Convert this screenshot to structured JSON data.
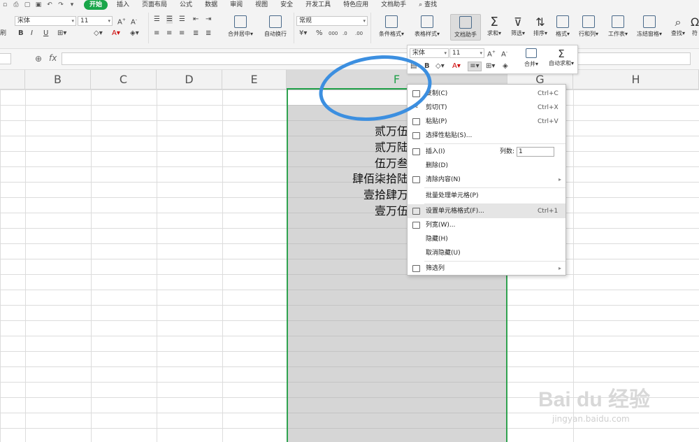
{
  "tabs": [
    "开始",
    "插入",
    "页面布局",
    "公式",
    "数据",
    "审阅",
    "视图",
    "安全",
    "开发工具",
    "特色应用",
    "文档助手",
    "查找"
  ],
  "ribbon": {
    "font_name": "宋体",
    "font_size": "11",
    "number_format": "常规",
    "bold": "B",
    "italic": "I",
    "underline": "U",
    "percent": "%",
    "font_color": "A",
    "merge": "合并居中",
    "wrap": "自动换行",
    "cond_format": "条件格式",
    "table_style": "表格样式",
    "doc_helper": "文档助手",
    "sum": "求和",
    "filter": "筛选",
    "sort": "排序",
    "format": "格式",
    "rowcol": "行和列",
    "sheet": "工作表",
    "freeze": "冻结窗格",
    "find": "查找",
    "more": "符",
    "brush": "刷"
  },
  "formula_bar": {
    "fx": "fx",
    "value": ""
  },
  "columns": [
    "B",
    "C",
    "D",
    "E",
    "F",
    "G",
    "H"
  ],
  "cells": [
    "贰万伍仟",
    "贰万陆仟",
    "伍万叁仟",
    "肆佰柒拾陆万肆仟",
    "壹拾肆万贰仟",
    "壹万伍仟"
  ],
  "mini_toolbar": {
    "font_name": "宋体",
    "font_size": "11",
    "bold": "B",
    "font_color": "A",
    "merge": "合并",
    "autosum": "自动求和"
  },
  "context_menu": [
    {
      "label": "复制(C)",
      "shortcut": "Ctrl+C",
      "icon": "copy-icon"
    },
    {
      "label": "剪切(T)",
      "shortcut": "Ctrl+X",
      "icon": "scissors-icon"
    },
    {
      "label": "粘贴(P)",
      "shortcut": "Ctrl+V",
      "icon": "paste-icon"
    },
    {
      "label": "选择性粘贴(S)...",
      "shortcut": "",
      "icon": "paste-special-icon"
    },
    {
      "label": "插入(I)",
      "shortcut": "",
      "icon": "insert-icon"
    },
    {
      "label": "删除(D)",
      "shortcut": "",
      "icon": ""
    },
    {
      "label": "清除内容(N)",
      "shortcut": "",
      "icon": "eraser-icon"
    },
    {
      "label": "批量处理单元格(P)",
      "shortcut": "",
      "icon": ""
    },
    {
      "label": "设置单元格格式(F)...",
      "shortcut": "Ctrl+1",
      "icon": "format-cells-icon"
    },
    {
      "label": "列宽(W)...",
      "shortcut": "",
      "icon": "column-width-icon"
    },
    {
      "label": "隐藏(H)",
      "shortcut": "",
      "icon": ""
    },
    {
      "label": "取消隐藏(U)",
      "shortcut": "",
      "icon": ""
    },
    {
      "label": "筛选列",
      "shortcut": "",
      "icon": "filter-column-icon"
    }
  ],
  "insert_cols": {
    "label": "列数:",
    "value": "1"
  },
  "watermark": {
    "brand": "Bai du 经验",
    "url": "jingyan.baidu.com"
  },
  "colors": {
    "accent": "#1aa64a",
    "annotation": "#3c8fe0",
    "selection": "#d6d6d6"
  }
}
